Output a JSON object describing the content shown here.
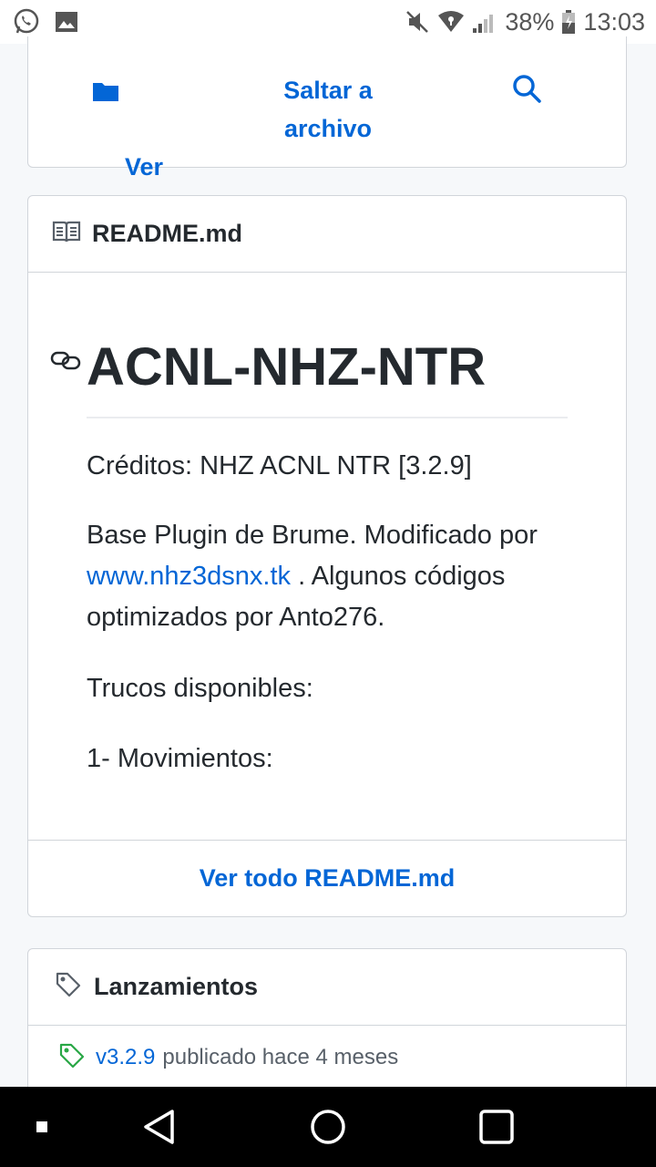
{
  "status_bar": {
    "battery": "38%",
    "time": "13:03"
  },
  "top_nav": {
    "view_code": "Ver\ncódigo",
    "jump_to_file": "Saltar a\narchivo"
  },
  "readme": {
    "filename": "README.md",
    "heading": "ACNL-NHZ-NTR",
    "credits": "Créditos: NHZ ACNL NTR [3.2.9]",
    "base_prefix": "Base Plugin de Brume. Modificado por",
    "base_link": "www.nhz3dsnx.tk",
    "base_suffix": ". Algunos códigos optimizados por Anto276.",
    "tricks": "Trucos disponibles:",
    "item1": "1- Movimientos:",
    "view_all": "Ver todo README.md"
  },
  "releases": {
    "title": "Lanzamientos",
    "latest_version": "v3.2.9",
    "latest_meta": "publicado hace 4 meses"
  },
  "colors": {
    "link": "#0366d6",
    "tag_green": "#28a745"
  }
}
